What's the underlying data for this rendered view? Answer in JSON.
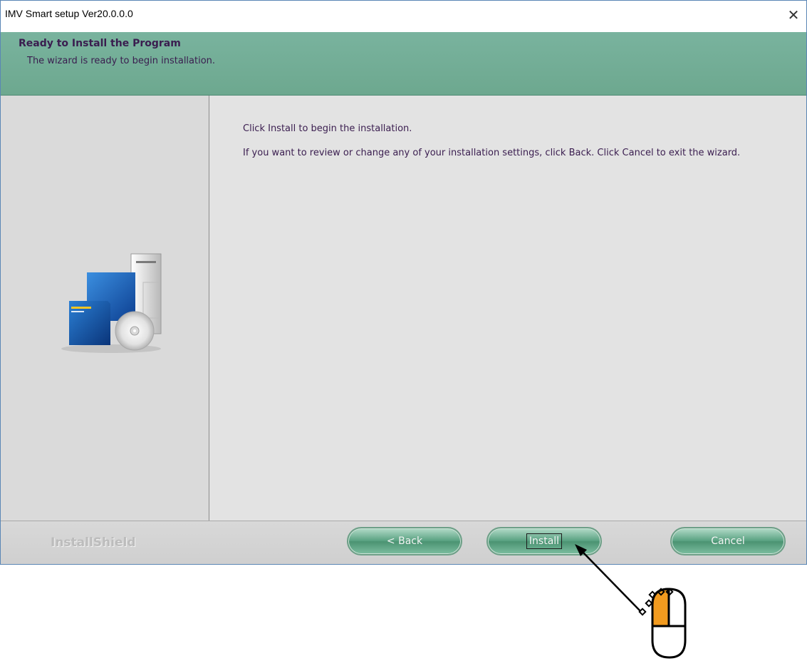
{
  "window": {
    "title": "IMV Smart setup Ver20.0.0.0",
    "close_glyph": "✕"
  },
  "header": {
    "title": "Ready to Install the Program",
    "subtitle": "The wizard is ready to begin installation."
  },
  "main": {
    "line1": "Click Install to begin the installation.",
    "line2": "If you want to review or change any of your installation settings, click Back. Click Cancel to exit the wizard."
  },
  "footer": {
    "brand": "InstallShield",
    "buttons": {
      "back": "< Back",
      "install": "Install",
      "cancel": "Cancel"
    }
  },
  "colors": {
    "banner": "#79b39e",
    "text": "#3a1d4f",
    "button": "#5aa282",
    "mouse_left_button": "#f29b1f"
  },
  "icons": {
    "left_pane": "computer-setup-icon",
    "annotation_arrow": "arrow-icon",
    "mouse": "mouse-left-click-icon"
  }
}
